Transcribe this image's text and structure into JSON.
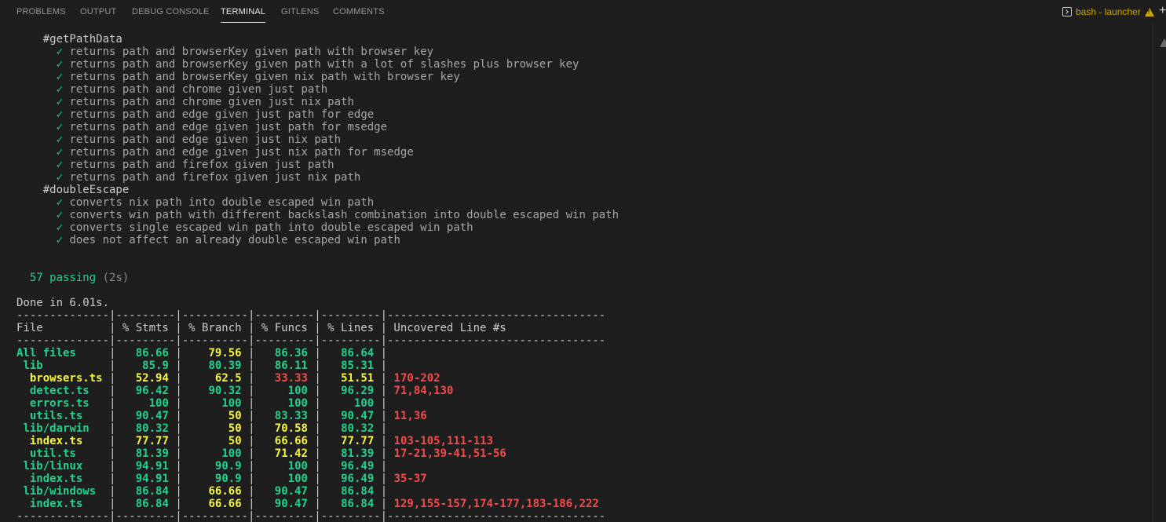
{
  "tabs": [
    {
      "label": "PROBLEMS"
    },
    {
      "label": "OUTPUT"
    },
    {
      "label": "DEBUG CONSOLE"
    },
    {
      "label": "TERMINAL",
      "active": true
    },
    {
      "label": "GITLENS"
    },
    {
      "label": "COMMENTS"
    }
  ],
  "terminal_instance": {
    "label": "bash - launcher",
    "icons": [
      "terminal-icon",
      "warning-icon"
    ]
  },
  "actions": {
    "new_terminal_glyph": "+"
  },
  "colors": {
    "background": "#1e1e1e",
    "pass_green": "#23d18b",
    "warn_yellow": "#f5f543",
    "fail_red": "#f14c4c",
    "active_tab": "#e7e7e7",
    "inactive_tab": "#969696"
  },
  "suites": [
    {
      "title": "#getPathData",
      "tests": [
        "returns path and browserKey given path with browser key",
        "returns path and browserKey given path with a lot of slashes plus browser key",
        "returns path and browserKey given nix path with browser key",
        "returns path and chrome given just path",
        "returns path and chrome given just nix path",
        "returns path and edge given just path for edge",
        "returns path and edge given just path for msedge",
        "returns path and edge given just nix path",
        "returns path and edge given just nix path for msedge",
        "returns path and firefox given just path",
        "returns path and firefox given just nix path"
      ]
    },
    {
      "title": "#doubleEscape",
      "tests": [
        "converts nix path into double escaped win path",
        "converts win path with different backslash combination into double escaped win path",
        "converts single escaped win path into double escaped win path",
        "does not affect an already double escaped win path"
      ]
    }
  ],
  "check_glyph": "✓",
  "summary": {
    "passing": "57 passing",
    "duration": "(2s)"
  },
  "done": "Done in 6.01s.",
  "coverage": {
    "separator": "--------------|---------|----------|---------|---------|---------------------------------",
    "header": "File          | % Stmts | % Branch | % Funcs | % Lines | Uncovered Line #s",
    "rows": [
      {
        "file": "All files",
        "indent": 0,
        "stmts": "86.66",
        "branch": "79.56",
        "funcs": "86.36",
        "lines": "86.64",
        "uncovered": "",
        "file_color": "green",
        "stmts_color": "green",
        "branch_color": "yellow",
        "funcs_color": "green",
        "lines_color": "green"
      },
      {
        "file": "lib",
        "indent": 1,
        "stmts": "85.9",
        "branch": "80.39",
        "funcs": "86.11",
        "lines": "85.31",
        "uncovered": "",
        "file_color": "green",
        "stmts_color": "green",
        "branch_color": "green",
        "funcs_color": "green",
        "lines_color": "green"
      },
      {
        "file": "browsers.ts",
        "indent": 2,
        "stmts": "52.94",
        "branch": "62.5",
        "funcs": "33.33",
        "lines": "51.51",
        "uncovered": "170-202",
        "file_color": "yellow",
        "stmts_color": "yellow",
        "branch_color": "yellow",
        "funcs_color": "red",
        "lines_color": "yellow"
      },
      {
        "file": "detect.ts",
        "indent": 2,
        "stmts": "96.42",
        "branch": "90.32",
        "funcs": "100",
        "lines": "96.29",
        "uncovered": "71,84,130",
        "file_color": "green",
        "stmts_color": "green",
        "branch_color": "green",
        "funcs_color": "green",
        "lines_color": "green"
      },
      {
        "file": "errors.ts",
        "indent": 2,
        "stmts": "100",
        "branch": "100",
        "funcs": "100",
        "lines": "100",
        "uncovered": "",
        "file_color": "green",
        "stmts_color": "green",
        "branch_color": "green",
        "funcs_color": "green",
        "lines_color": "green"
      },
      {
        "file": "utils.ts",
        "indent": 2,
        "stmts": "90.47",
        "branch": "50",
        "funcs": "83.33",
        "lines": "90.47",
        "uncovered": "11,36",
        "file_color": "green",
        "stmts_color": "green",
        "branch_color": "yellow",
        "funcs_color": "green",
        "lines_color": "green"
      },
      {
        "file": "lib/darwin",
        "indent": 1,
        "stmts": "80.32",
        "branch": "50",
        "funcs": "70.58",
        "lines": "80.32",
        "uncovered": "",
        "file_color": "green",
        "stmts_color": "green",
        "branch_color": "yellow",
        "funcs_color": "yellow",
        "lines_color": "green"
      },
      {
        "file": "index.ts",
        "indent": 2,
        "stmts": "77.77",
        "branch": "50",
        "funcs": "66.66",
        "lines": "77.77",
        "uncovered": "103-105,111-113",
        "file_color": "yellow",
        "stmts_color": "yellow",
        "branch_color": "yellow",
        "funcs_color": "yellow",
        "lines_color": "yellow"
      },
      {
        "file": "util.ts",
        "indent": 2,
        "stmts": "81.39",
        "branch": "100",
        "funcs": "71.42",
        "lines": "81.39",
        "uncovered": "17-21,39-41,51-56",
        "file_color": "green",
        "stmts_color": "green",
        "branch_color": "green",
        "funcs_color": "yellow",
        "lines_color": "green"
      },
      {
        "file": "lib/linux",
        "indent": 1,
        "stmts": "94.91",
        "branch": "90.9",
        "funcs": "100",
        "lines": "96.49",
        "uncovered": "",
        "file_color": "green",
        "stmts_color": "green",
        "branch_color": "green",
        "funcs_color": "green",
        "lines_color": "green"
      },
      {
        "file": "index.ts",
        "indent": 2,
        "stmts": "94.91",
        "branch": "90.9",
        "funcs": "100",
        "lines": "96.49",
        "uncovered": "35-37",
        "file_color": "green",
        "stmts_color": "green",
        "branch_color": "green",
        "funcs_color": "green",
        "lines_color": "green"
      },
      {
        "file": "lib/windows",
        "indent": 1,
        "stmts": "86.84",
        "branch": "66.66",
        "funcs": "90.47",
        "lines": "86.84",
        "uncovered": "",
        "file_color": "green",
        "stmts_color": "green",
        "branch_color": "yellow",
        "funcs_color": "green",
        "lines_color": "green"
      },
      {
        "file": "index.ts",
        "indent": 2,
        "stmts": "86.84",
        "branch": "66.66",
        "funcs": "90.47",
        "lines": "86.84",
        "uncovered": "129,155-157,174-177,183-186,222",
        "file_color": "green",
        "stmts_color": "green",
        "branch_color": "yellow",
        "funcs_color": "green",
        "lines_color": "green"
      }
    ]
  }
}
